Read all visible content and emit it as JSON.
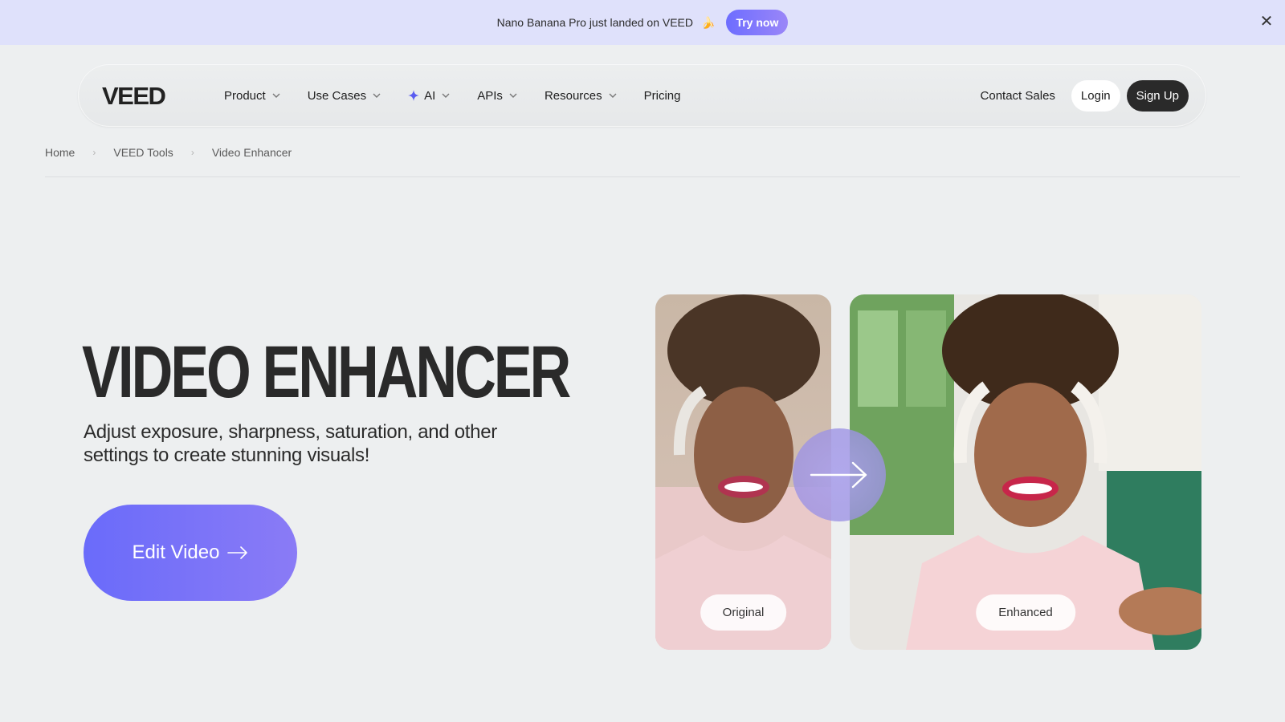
{
  "announcement": {
    "text": "Nano Banana Pro just landed on VEED",
    "emoji": "🍌",
    "cta": "Try now",
    "close": "✕"
  },
  "nav": {
    "logo": "VEED",
    "items": [
      {
        "label": "Product",
        "has_dropdown": true
      },
      {
        "label": "Use Cases",
        "has_dropdown": true
      },
      {
        "label": "AI",
        "has_dropdown": true,
        "icon": "sparkle-icon"
      },
      {
        "label": "APIs",
        "has_dropdown": true
      },
      {
        "label": "Resources",
        "has_dropdown": true
      },
      {
        "label": "Pricing",
        "has_dropdown": false
      }
    ],
    "contact": "Contact Sales",
    "login": "Login",
    "signup": "Sign Up"
  },
  "breadcrumb": [
    "Home",
    "VEED Tools",
    "Video Enhancer"
  ],
  "hero": {
    "title": "VIDEO ENHANCER",
    "subtitle": "Adjust exposure, sharpness, saturation, and other settings to create stunning visuals!",
    "cta": "Edit Video"
  },
  "comparison": {
    "before_label": "Original",
    "after_label": "Enhanced"
  },
  "colors": {
    "accent": "#6d6dff",
    "announcement_bg": "#dfe1fb",
    "page_bg": "#edeff0",
    "signup_bg": "#2a2a2a"
  }
}
